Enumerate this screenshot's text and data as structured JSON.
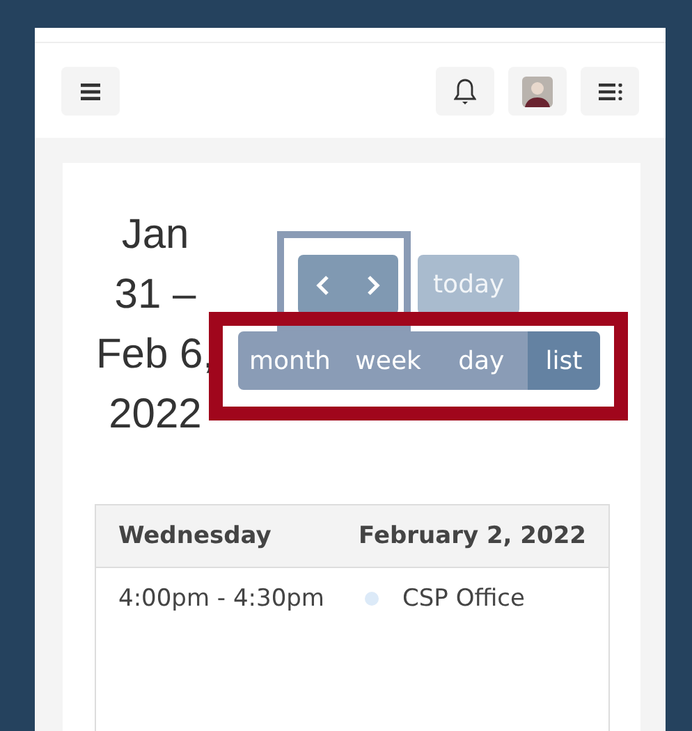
{
  "toolbar": {
    "buttons": [
      {
        "kind": "menu"
      },
      {
        "kind": "bell"
      },
      {
        "kind": "avatar"
      },
      {
        "kind": "list"
      }
    ]
  },
  "calendar": {
    "title": "Jan 31 – Feb 6, 2022",
    "nav": {
      "buttons": [
        {
          "kind": "prev"
        },
        {
          "kind": "next"
        }
      ],
      "highlighted": true
    },
    "today": {
      "label": "today",
      "disabled": true
    },
    "views": {
      "buttons": [
        {
          "label": "month",
          "selected": false
        },
        {
          "label": "week",
          "selected": false
        },
        {
          "label": "day",
          "selected": false
        },
        {
          "label": "list",
          "selected": true
        }
      ],
      "highlighted": true
    },
    "list": {
      "day": "Wednesday",
      "date": "February 2, 2022",
      "events": [
        {
          "time": "4:00pm - 4:30pm",
          "title": "CSP Office",
          "color": "#dceaf8"
        }
      ]
    }
  }
}
